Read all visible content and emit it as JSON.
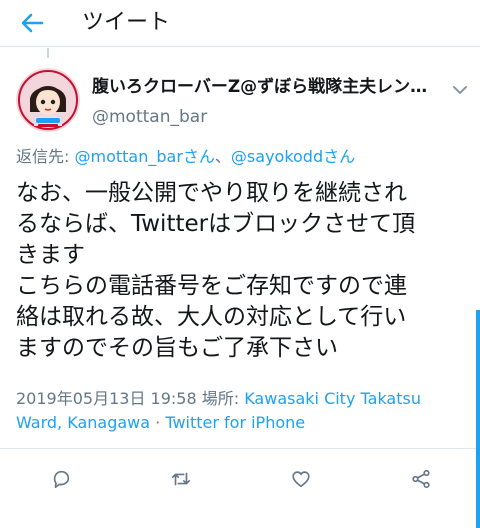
{
  "colors": {
    "accent": "#1da1f2",
    "text": "#14171a",
    "secondary": "#657786",
    "divider": "#e1e8ed"
  },
  "header": {
    "back_icon": "arrow-left-icon",
    "title": "ツイート"
  },
  "tweet": {
    "author": {
      "display_name": "腹いろクローバーZ@ずぼら戦隊主夫レン…",
      "handle": "@mottan_bar",
      "avatar_icon": "user-avatar"
    },
    "reply_to": {
      "prefix": "返信先: ",
      "user1": "@mottan_barさん",
      "separator": "、",
      "user2": "@sayokoddさん"
    },
    "text_lines": [
      "なお、一般公開でやり取りを継続され",
      "るならば、Twitterはブロックさせて頂",
      "きます",
      "こちらの電話番号をご存知ですので連",
      "絡は取れる故、大人の対応として行い",
      "ますのでその旨もご了承下さい"
    ],
    "meta": {
      "timestamp": "2019年05月13日 19:58",
      "place_prefix": " 場所: ",
      "place": "Kawasaki City Takatsu Ward, Kanagawa",
      "dot": " · ",
      "source": "Twitter for iPhone"
    },
    "actions": {
      "reply_icon": "reply-icon",
      "retweet_icon": "retweet-icon",
      "like_icon": "heart-icon",
      "share_icon": "share-icon"
    }
  }
}
